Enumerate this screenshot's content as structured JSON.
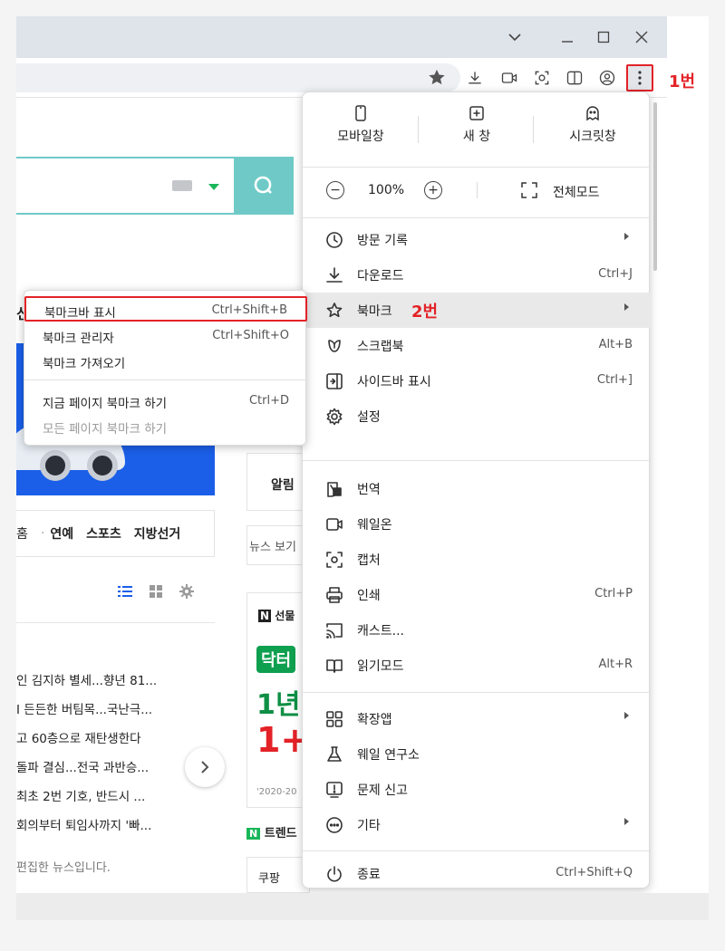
{
  "callouts": {
    "step1": "1번",
    "step2": "2번"
  },
  "page_content": {
    "partial_heading": "신",
    "nav_strip": [
      "홈",
      "연예",
      "스포츠",
      "지방선거"
    ],
    "mid_col": {
      "alert": "알림",
      "news_view": "뉴스 보기"
    },
    "news_items": [
      "인 김지하 별세...향년 81...",
      "I 든든한 버팀목...국난극...",
      "고 60층으로 재탄생한다",
      "돌파 결심...전국 과반승...",
      "최초 2번 기호, 반드시 ...",
      "회의부터 퇴임사까지 '빠..."
    ],
    "edited_note": "편집한 뉴스입니다.",
    "ad_texts": [
      "선물",
      "닥터",
      "1년",
      "1+",
      "'2020-20"
    ],
    "trend_label": "트렌드",
    "trend_item": "쿠팡"
  },
  "menu": {
    "top_actions": [
      {
        "label": "모바일창",
        "icon": "mobile-window-icon"
      },
      {
        "label": "새 창",
        "icon": "new-window-icon"
      },
      {
        "label": "시크릿창",
        "icon": "secret-window-icon"
      }
    ],
    "zoom": {
      "minus": "−",
      "value": "100%",
      "plus": "+",
      "fullscreen_label": "전체모드"
    },
    "items": [
      {
        "label": "방문 기록",
        "shortcut": "",
        "submenu": true,
        "icon": "history-icon"
      },
      {
        "label": "다운로드",
        "shortcut": "Ctrl+J",
        "submenu": false,
        "icon": "download-icon"
      },
      {
        "label": "북마크",
        "shortcut": "",
        "submenu": true,
        "icon": "star-icon",
        "active": true
      },
      {
        "label": "스크랩북",
        "shortcut": "Alt+B",
        "submenu": false,
        "icon": "scrapbook-icon"
      },
      {
        "label": "사이드바 표시",
        "shortcut": "Ctrl+]",
        "submenu": false,
        "icon": "sidebar-icon"
      },
      {
        "label": "설정",
        "shortcut": "",
        "submenu": false,
        "icon": "gear-icon"
      },
      {
        "label": "번역",
        "shortcut": "",
        "submenu": false,
        "icon": "translate-icon"
      },
      {
        "label": "웨일온",
        "shortcut": "",
        "submenu": false,
        "icon": "whale-on-icon"
      },
      {
        "label": "캡처",
        "shortcut": "",
        "submenu": false,
        "icon": "capture-icon"
      },
      {
        "label": "인쇄",
        "shortcut": "Ctrl+P",
        "submenu": false,
        "icon": "print-icon"
      },
      {
        "label": "캐스트...",
        "shortcut": "",
        "submenu": false,
        "icon": "cast-icon"
      },
      {
        "label": "읽기모드",
        "shortcut": "Alt+R",
        "submenu": false,
        "icon": "reading-mode-icon"
      },
      {
        "label": "확장앱",
        "shortcut": "",
        "submenu": true,
        "icon": "extensions-icon"
      },
      {
        "label": "웨일 연구소",
        "shortcut": "",
        "submenu": false,
        "icon": "lab-flask-icon"
      },
      {
        "label": "문제 신고",
        "shortcut": "",
        "submenu": false,
        "icon": "report-icon"
      },
      {
        "label": "기타",
        "shortcut": "",
        "submenu": true,
        "icon": "more-circle-icon"
      },
      {
        "label": "종료",
        "shortcut": "Ctrl+Shift+Q",
        "submenu": false,
        "icon": "power-icon"
      }
    ]
  },
  "bookmark_submenu": [
    {
      "label": "북마크바 표시",
      "shortcut": "Ctrl+Shift+B",
      "highlight": true
    },
    {
      "label": "북마크 관리자",
      "shortcut": "Ctrl+Shift+O"
    },
    {
      "label": "북마크 가져오기",
      "shortcut": ""
    },
    {
      "label": "지금 페이지 북마크 하기",
      "shortcut": "Ctrl+D"
    },
    {
      "label": "모든 페이지 북마크 하기",
      "shortcut": "",
      "disabled": true
    }
  ],
  "colors": {
    "accent_red": "#e32227",
    "naver_teal": "#6fcac7",
    "banner_blue": "#1b5fe8",
    "naver_green": "#19b65a"
  }
}
